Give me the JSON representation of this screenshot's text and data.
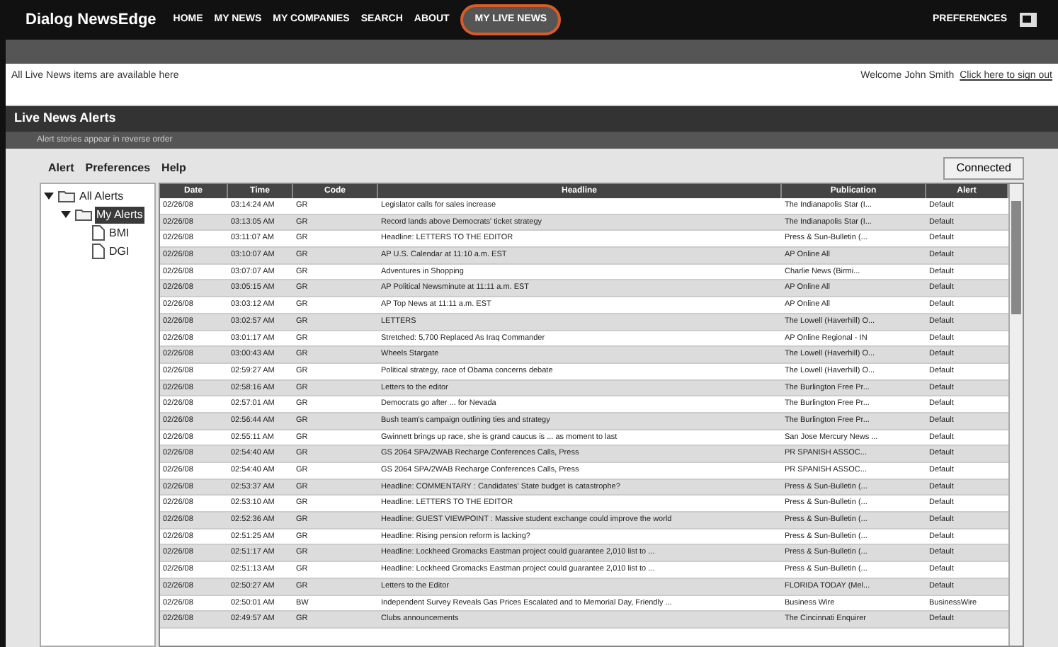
{
  "header": {
    "logo": "Dialog NewsEdge",
    "nav": [
      {
        "label": "HOME",
        "selected": false
      },
      {
        "label": "MY NEWS",
        "selected": false
      },
      {
        "label": "MY COMPANIES",
        "selected": false
      },
      {
        "label": "SEARCH",
        "selected": false
      },
      {
        "label": "ABOUT",
        "selected": false
      },
      {
        "label": "MY LIVE NEWS",
        "selected": true
      }
    ],
    "tools": "PREFERENCES"
  },
  "info_bar": {
    "message": "All Live News items are available here",
    "welcome": "Welcome John Smith",
    "signout": "Click here to sign out"
  },
  "panel": {
    "title": "Live News Alerts",
    "subtitle": "Alert stories appear in reverse order"
  },
  "menu": [
    "Alert",
    "Preferences",
    "Help"
  ],
  "status_button": "Connected",
  "tree": [
    {
      "label": "All Alerts",
      "expanded": true,
      "children": [
        {
          "label": "My Alerts",
          "expanded": true,
          "selected": true,
          "children": [
            {
              "label": "BMI"
            },
            {
              "label": "DGI"
            }
          ]
        }
      ]
    }
  ],
  "table": {
    "columns": [
      "Date",
      "Time",
      "Code",
      "Headline",
      "Publication",
      "Alert"
    ],
    "rows": [
      [
        "02/26/08",
        "03:14:24 AM",
        "GR",
        "Legislator calls for sales increase",
        "The Indianapolis Star (I...",
        "Default"
      ],
      [
        "02/26/08",
        "03:13:05 AM",
        "GR",
        "Record lands above Democrats' ticket strategy",
        "The Indianapolis Star (I...",
        "Default"
      ],
      [
        "02/26/08",
        "03:11:07 AM",
        "GR",
        "Headline: LETTERS TO THE EDITOR",
        "Press & Sun-Bulletin (...",
        "Default"
      ],
      [
        "02/26/08",
        "03:10:07 AM",
        "GR",
        "AP U.S. Calendar at 11:10 a.m. EST",
        "AP Online All",
        "Default"
      ],
      [
        "02/26/08",
        "03:07:07 AM",
        "GR",
        "Adventures in Shopping",
        "Charlie News (Birmi...",
        "Default"
      ],
      [
        "02/26/08",
        "03:05:15 AM",
        "GR",
        "AP Political Newsminute at 11:11 a.m. EST",
        "AP Online All",
        "Default"
      ],
      [
        "02/26/08",
        "03:03:12 AM",
        "GR",
        "AP Top News at 11:11 a.m. EST",
        "AP Online All",
        "Default"
      ],
      [
        "02/26/08",
        "03:02:57 AM",
        "GR",
        "LETTERS",
        "The Lowell (Haverhill) O...",
        "Default"
      ],
      [
        "02/26/08",
        "03:01:17 AM",
        "GR",
        "Stretched: 5,700 Replaced As Iraq Commander",
        "AP Online Regional - IN",
        "Default"
      ],
      [
        "02/26/08",
        "03:00:43 AM",
        "GR",
        "Wheels Stargate",
        "The Lowell (Haverhill) O...",
        "Default"
      ],
      [
        "02/26/08",
        "02:59:27 AM",
        "GR",
        "Political strategy, race of Obama concerns debate",
        "The Lowell (Haverhill) O...",
        "Default"
      ],
      [
        "02/26/08",
        "02:58:16 AM",
        "GR",
        "Letters to the editor",
        "The Burlington Free Pr...",
        "Default"
      ],
      [
        "02/26/08",
        "02:57:01 AM",
        "GR",
        "Democrats go after ... for Nevada",
        "The Burlington Free Pr...",
        "Default"
      ],
      [
        "02/26/08",
        "02:56:44 AM",
        "GR",
        "Bush team's campaign outlining ties and strategy",
        "The Burlington Free Pr...",
        "Default"
      ],
      [
        "02/26/08",
        "02:55:11 AM",
        "GR",
        "Gwinnett brings up race, she is grand caucus is ... as moment to last",
        "San Jose Mercury News ...",
        "Default"
      ],
      [
        "02/26/08",
        "02:54:40 AM",
        "GR",
        "GS 2064 SPA/2WAB Recharge Conferences Calls, Press",
        "PR SPANISH ASSOC...",
        "Default"
      ],
      [
        "02/26/08",
        "02:54:40 AM",
        "GR",
        "GS 2064 SPA/2WAB Recharge Conferences Calls, Press",
        "PR SPANISH ASSOC...",
        "Default"
      ],
      [
        "02/26/08",
        "02:53:37 AM",
        "GR",
        "Headline: COMMENTARY : Candidates' State budget is catastrophe?",
        "Press & Sun-Bulletin (...",
        "Default"
      ],
      [
        "02/26/08",
        "02:53:10 AM",
        "GR",
        "Headline: LETTERS TO THE EDITOR",
        "Press & Sun-Bulletin (...",
        "Default"
      ],
      [
        "02/26/08",
        "02:52:36 AM",
        "GR",
        "Headline: GUEST VIEWPOINT : Massive student exchange could improve the world",
        "Press & Sun-Bulletin (...",
        "Default"
      ],
      [
        "02/26/08",
        "02:51:25 AM",
        "GR",
        "Headline: Rising pension reform is lacking?",
        "Press & Sun-Bulletin (...",
        "Default"
      ],
      [
        "02/26/08",
        "02:51:17 AM",
        "GR",
        "Headline: Lockheed Gromacks Eastman project could guarantee 2,010 list to ...",
        "Press & Sun-Bulletin (...",
        "Default"
      ],
      [
        "02/26/08",
        "02:51:13 AM",
        "GR",
        "Headline: Lockheed Gromacks Eastman project could guarantee 2,010 list to ...",
        "Press & Sun-Bulletin (...",
        "Default"
      ],
      [
        "02/26/08",
        "02:50:27 AM",
        "GR",
        "Letters to the Editor",
        "FLORIDA TODAY (Mel...",
        "Default"
      ],
      [
        "02/26/08",
        "02:50:01 AM",
        "BW",
        "Independent Survey Reveals Gas Prices Escalated and to Memorial Day, Friendly ...",
        "Business Wire",
        "BusinessWire"
      ],
      [
        "02/26/08",
        "02:49:57 AM",
        "GR",
        "Clubs announcements",
        "The Cincinnati Enquirer",
        "Default"
      ]
    ]
  }
}
